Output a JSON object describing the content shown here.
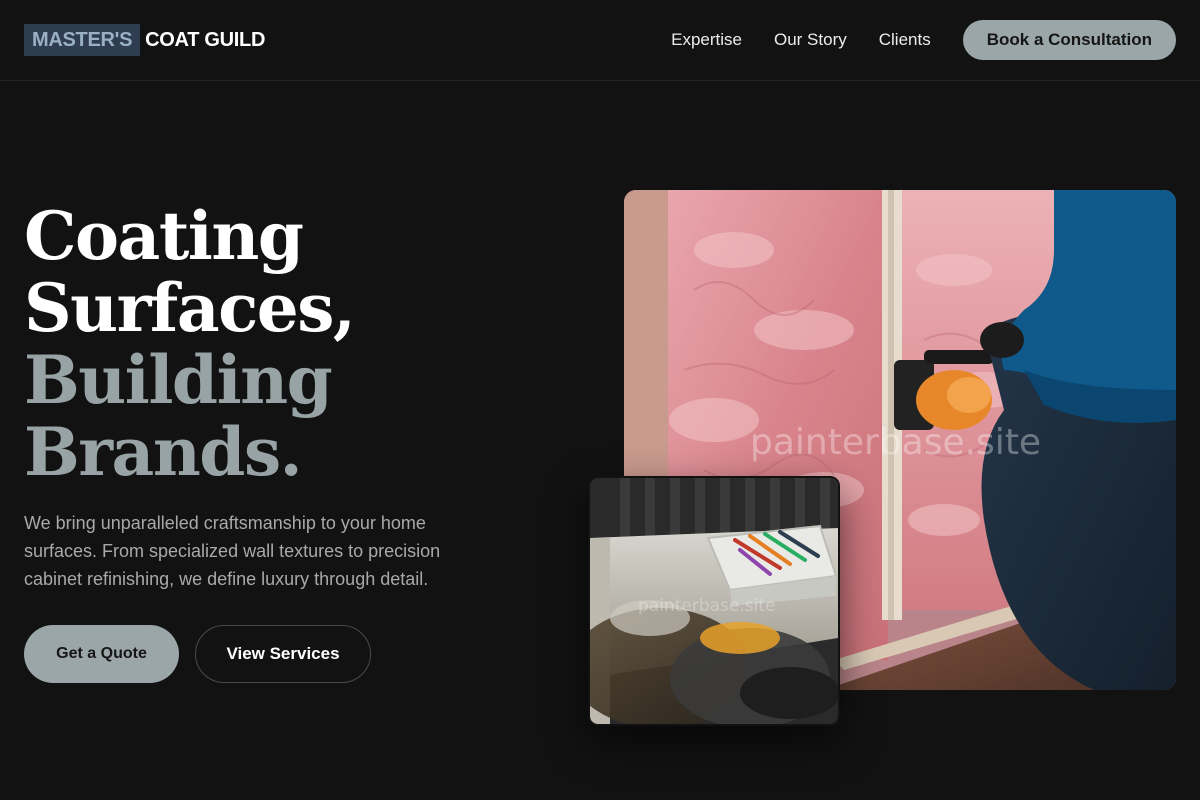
{
  "brand": {
    "highlight": "MASTER'S",
    "rest": "COAT GUILD"
  },
  "nav": {
    "links": [
      "Expertise",
      "Our Story",
      "Clients"
    ],
    "cta": "Book a Consultation"
  },
  "hero": {
    "title_lines": [
      "Coating",
      "Surfaces,",
      "Building",
      "Brands."
    ],
    "subtitle": "We bring unparalleled craftsmanship to your home surfaces. From specialized wall textures to precision cabinet refinishing, we define luxury through detail.",
    "primary_button": "Get a Quote",
    "secondary_button": "View Services"
  },
  "images": {
    "main_watermark": "painterbase.site",
    "small_watermark": "painterbase.site"
  },
  "colors": {
    "background": "#121212",
    "accent": "#9aa6a8",
    "logo_highlight_bg": "#2e3d50",
    "muted_title": "#97a3a4"
  }
}
